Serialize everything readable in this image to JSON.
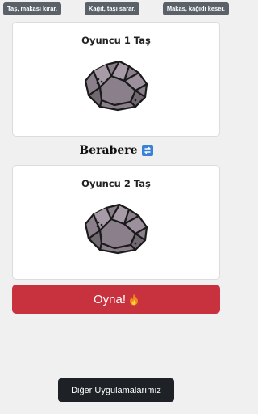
{
  "rules": [
    "Taş, makası kırar.",
    "Kağıt, taşı sarar.",
    "Makas, kağıdı keser."
  ],
  "player1": {
    "title": "Oyuncu 1 Taş",
    "choice_icon": "rock-icon"
  },
  "player2": {
    "title": "Oyuncu 2 Taş",
    "choice_icon": "rock-icon"
  },
  "result": {
    "text": "Berabere",
    "icon": "repeat-icon"
  },
  "play_button": {
    "label": "Oyna!",
    "icon": "fire-icon"
  },
  "other_apps_button": {
    "label": "Diğer Uygulamalarımız"
  },
  "colors": {
    "background": "#f0f0f0",
    "rule_badge": "#5a6169",
    "play_button": "#c8323e",
    "other_apps_button": "#1e2226",
    "rock": "#8a7f8a",
    "result_icon": "#3b82d6"
  }
}
